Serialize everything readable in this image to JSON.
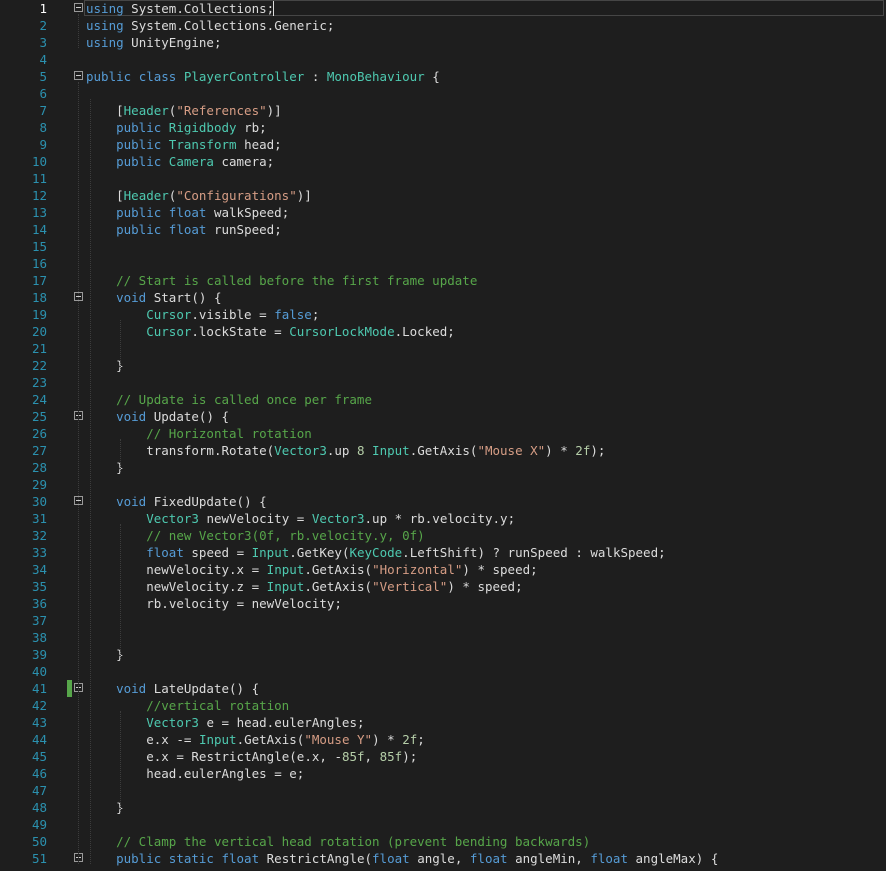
{
  "editor": {
    "lines": [
      {
        "n": "1",
        "text": "using System.Collections;"
      },
      {
        "n": "2",
        "text": "using System.Collections.Generic;"
      },
      {
        "n": "3",
        "text": "using UnityEngine;"
      },
      {
        "n": "4",
        "text": ""
      },
      {
        "n": "5",
        "text": "public class PlayerController : MonoBehaviour {"
      },
      {
        "n": "6",
        "text": ""
      },
      {
        "n": "7",
        "text": "    [Header(\"References\")]"
      },
      {
        "n": "8",
        "text": "    public Rigidbody rb;"
      },
      {
        "n": "9",
        "text": "    public Transform head;"
      },
      {
        "n": "10",
        "text": "    public Camera camera;"
      },
      {
        "n": "11",
        "text": ""
      },
      {
        "n": "12",
        "text": "    [Header(\"Configurations\")]"
      },
      {
        "n": "13",
        "text": "    public float walkSpeed;"
      },
      {
        "n": "14",
        "text": "    public float runSpeed;"
      },
      {
        "n": "15",
        "text": ""
      },
      {
        "n": "16",
        "text": ""
      },
      {
        "n": "17",
        "text": "    // Start is called before the first frame update"
      },
      {
        "n": "18",
        "text": "    void Start() {"
      },
      {
        "n": "19",
        "text": "        Cursor.visible = false;"
      },
      {
        "n": "20",
        "text": "        Cursor.lockState = CursorLockMode.Locked;"
      },
      {
        "n": "21",
        "text": ""
      },
      {
        "n": "22",
        "text": "    }"
      },
      {
        "n": "23",
        "text": ""
      },
      {
        "n": "24",
        "text": "    // Update is called once per frame"
      },
      {
        "n": "25",
        "text": "    void Update() {"
      },
      {
        "n": "26",
        "text": "        // Horizontal rotation"
      },
      {
        "n": "27",
        "text": "        transform.Rotate(Vector3.up 8 Input.GetAxis(\"Mouse X\") * 2f);"
      },
      {
        "n": "28",
        "text": "    }"
      },
      {
        "n": "29",
        "text": ""
      },
      {
        "n": "30",
        "text": "    void FixedUpdate() {"
      },
      {
        "n": "31",
        "text": "        Vector3 newVelocity = Vector3.up * rb.velocity.y;"
      },
      {
        "n": "32",
        "text": "        // new Vector3(0f, rb.velocity.y, 0f)"
      },
      {
        "n": "33",
        "text": "        float speed = Input.GetKey(KeyCode.LeftShift) ? runSpeed : walkSpeed;"
      },
      {
        "n": "34",
        "text": "        newVelocity.x = Input.GetAxis(\"Horizontal\") * speed;"
      },
      {
        "n": "35",
        "text": "        newVelocity.z = Input.GetAxis(\"Vertical\") * speed;"
      },
      {
        "n": "36",
        "text": "        rb.velocity = newVelocity;"
      },
      {
        "n": "37",
        "text": ""
      },
      {
        "n": "38",
        "text": ""
      },
      {
        "n": "39",
        "text": "    }"
      },
      {
        "n": "40",
        "text": ""
      },
      {
        "n": "41",
        "text": "    void LateUpdate() {"
      },
      {
        "n": "42",
        "text": "        //vertical rotation"
      },
      {
        "n": "43",
        "text": "        Vector3 e = head.eulerAngles;"
      },
      {
        "n": "44",
        "text": "        e.x -= Input.GetAxis(\"Mouse Y\") * 2f;"
      },
      {
        "n": "45",
        "text": "        e.x = RestrictAngle(e.x, -85f, 85f);"
      },
      {
        "n": "46",
        "text": "        head.eulerAngles = e;"
      },
      {
        "n": "47",
        "text": ""
      },
      {
        "n": "48",
        "text": "    }"
      },
      {
        "n": "49",
        "text": ""
      },
      {
        "n": "50",
        "text": "    // Clamp the vertical head rotation (prevent bending backwards)"
      },
      {
        "n": "51",
        "text": "    public static float RestrictAngle(float angle, float angleMin, float angleMax) {"
      }
    ],
    "colors": {
      "background": "#1e1e1e",
      "keyword": "#569cd6",
      "type": "#4ec9b0",
      "string": "#d69d85",
      "comment": "#57a64a",
      "number": "#b5cea8",
      "line_number": "#2b91af",
      "text": "#dcdcdc"
    },
    "current_line": 1,
    "fold_lines": [
      1,
      5,
      18,
      25,
      30,
      41,
      51
    ],
    "changed_lines": [
      41
    ]
  }
}
